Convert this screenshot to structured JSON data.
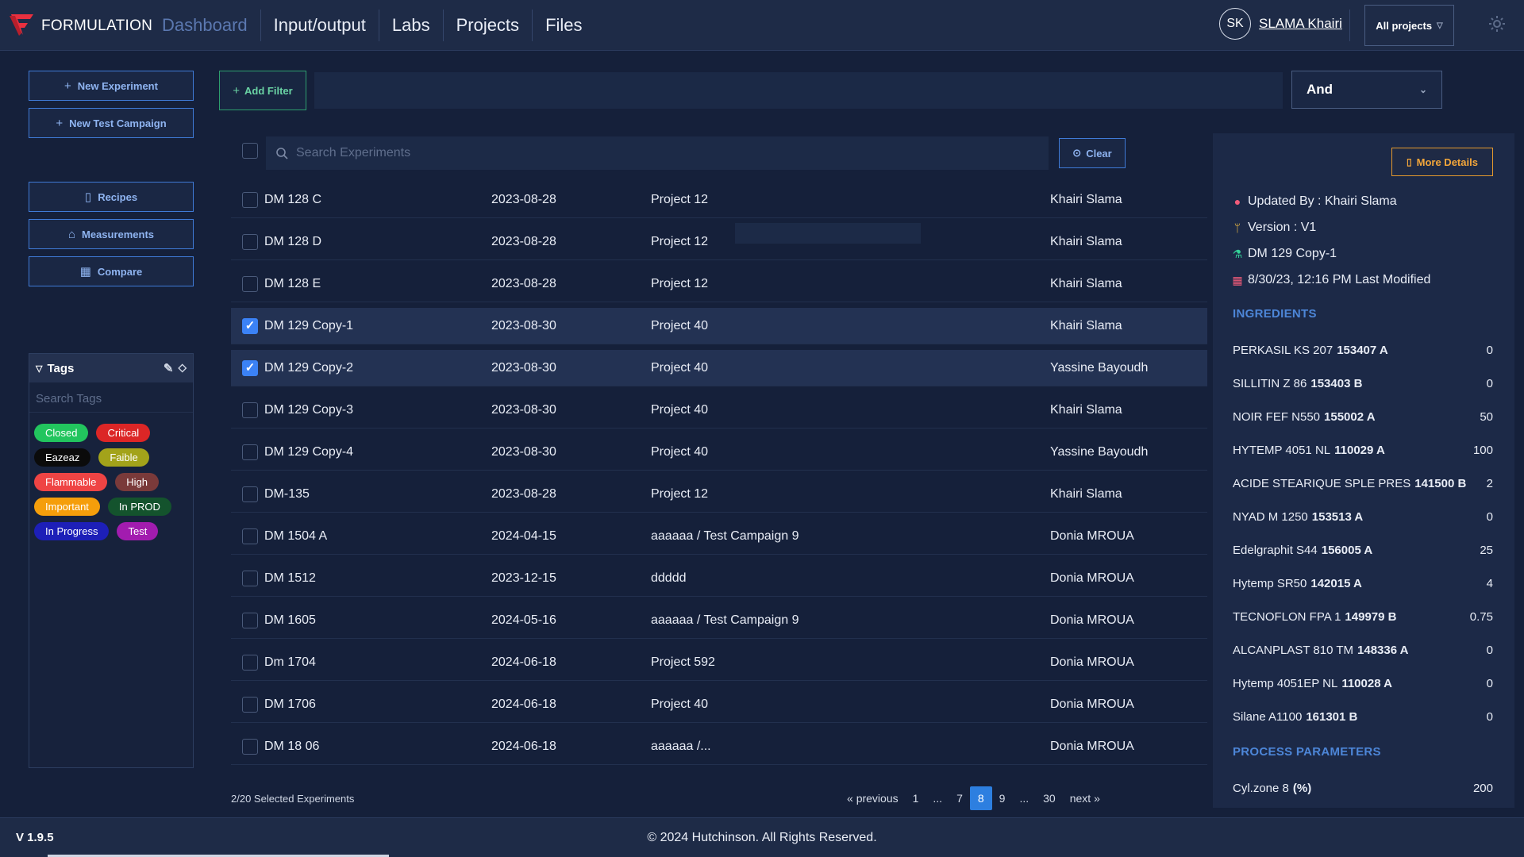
{
  "brand": {
    "name": "FORMULATION",
    "color": "#e8303f"
  },
  "nav": {
    "items": [
      "Dashboard",
      "Input/output",
      "Labs",
      "Projects",
      "Files"
    ],
    "active": "Dashboard"
  },
  "user": {
    "initials": "SK",
    "name": "SLAMA Khairi"
  },
  "project_select": {
    "value": "All projects"
  },
  "sidebar": {
    "new_experiment": "New Experiment",
    "new_test_campaign": "New Test Campaign",
    "recipes": "Recipes",
    "measurements": "Measurements",
    "compare": "Compare"
  },
  "tags": {
    "title": "Tags",
    "search_placeholder": "Search Tags",
    "items": [
      {
        "label": "Closed",
        "color": "#22c55e"
      },
      {
        "label": "Critical",
        "color": "#dc2626"
      },
      {
        "label": "Eazeaz",
        "color": "#0b0b0b"
      },
      {
        "label": "Faible",
        "color": "#a3a31a"
      },
      {
        "label": "Flammable",
        "color": "#ef4444"
      },
      {
        "label": "High",
        "color": "#7a3a3a"
      },
      {
        "label": "Important",
        "color": "#f59e0b"
      },
      {
        "label": "In PROD",
        "color": "#14532d"
      },
      {
        "label": "In Progress",
        "color": "#1d1fb8"
      },
      {
        "label": "Test",
        "color": "#a21caf"
      }
    ]
  },
  "filter": {
    "add_label": "Add Filter",
    "operator": "And"
  },
  "table": {
    "search_placeholder": "Search Experiments",
    "clear_label": "Clear",
    "rows": [
      {
        "name": "DM 128 C",
        "date": "2023-08-28",
        "project": "Project 12",
        "owner": "Khairi Slama",
        "checked": false
      },
      {
        "name": "DM 128 D",
        "date": "2023-08-28",
        "project": "Project 12",
        "owner": "Khairi Slama",
        "checked": false
      },
      {
        "name": "DM 128 E",
        "date": "2023-08-28",
        "project": "Project 12",
        "owner": "Khairi Slama",
        "checked": false
      },
      {
        "name": "DM 129 Copy-1",
        "date": "2023-08-30",
        "project": "Project 40",
        "owner": "Khairi Slama",
        "checked": true
      },
      {
        "name": "DM 129 Copy-2",
        "date": "2023-08-30",
        "project": "Project 40",
        "owner": "Yassine Bayoudh",
        "checked": true
      },
      {
        "name": "DM 129 Copy-3",
        "date": "2023-08-30",
        "project": "Project 40",
        "owner": "Khairi Slama",
        "checked": false
      },
      {
        "name": "DM 129 Copy-4",
        "date": "2023-08-30",
        "project": "Project 40",
        "owner": "Yassine Bayoudh",
        "checked": false
      },
      {
        "name": "DM-135",
        "date": "2023-08-28",
        "project": "Project 12",
        "owner": "Khairi Slama",
        "checked": false
      },
      {
        "name": "DM 1504 A",
        "date": "2024-04-15",
        "project": "aaaaaa / Test Campaign 9",
        "owner": "Donia MROUA",
        "checked": false
      },
      {
        "name": "DM 1512",
        "date": "2023-12-15",
        "project": "ddddd",
        "owner": "Donia MROUA",
        "checked": false
      },
      {
        "name": "DM 1605",
        "date": "2024-05-16",
        "project": "aaaaaa / Test Campaign 9",
        "owner": "Donia MROUA",
        "checked": false
      },
      {
        "name": "Dm 1704",
        "date": "2024-06-18",
        "project": "Project 592",
        "owner": "Donia MROUA",
        "checked": false
      },
      {
        "name": "DM 1706",
        "date": "2024-06-18",
        "project": "Project 40",
        "owner": "Donia MROUA",
        "checked": false
      },
      {
        "name": "DM 18 06",
        "date": "2024-06-18",
        "project": "aaaaaa /...",
        "owner": "Donia MROUA",
        "checked": false
      }
    ],
    "status": "2/20 Selected Experiments"
  },
  "pagination": {
    "previous": "previous",
    "next": "next",
    "pages": [
      "1",
      "...",
      "7",
      "8",
      "9",
      "...",
      "30"
    ],
    "current": "8"
  },
  "details": {
    "more_button": "More Details",
    "updated_by": "Updated By : Khairi Slama",
    "version": "Version : V1",
    "experiment": "DM 129 Copy-1",
    "last_modified": "8/30/23, 12:16 PM Last Modified",
    "ingredients_title": "INGREDIENTS",
    "ingredients": [
      {
        "name": "PERKASIL KS 207",
        "code": "153407 A",
        "value": "0"
      },
      {
        "name": "SILLITIN Z 86",
        "code": "153403 B",
        "value": "0"
      },
      {
        "name": "NOIR FEF N550",
        "code": "155002 A",
        "value": "50"
      },
      {
        "name": "HYTEMP 4051 NL",
        "code": "110029 A",
        "value": "100"
      },
      {
        "name": "ACIDE STEARIQUE SPLE PRES",
        "code": "141500 B",
        "value": "2"
      },
      {
        "name": "NYAD M 1250",
        "code": "153513 A",
        "value": "0"
      },
      {
        "name": "Edelgraphit S44",
        "code": "156005 A",
        "value": "25"
      },
      {
        "name": "Hytemp SR50",
        "code": "142015 A",
        "value": "4"
      },
      {
        "name": "TECNOFLON FPA 1",
        "code": "149979 B",
        "value": "0.75"
      },
      {
        "name": "ALCANPLAST 810 TM",
        "code": "148336 A",
        "value": "0"
      },
      {
        "name": "Hytemp 4051EP NL",
        "code": "110028 A",
        "value": "0"
      },
      {
        "name": "Silane A1100",
        "code": "161301 B",
        "value": "0"
      }
    ],
    "process_title": "PROCESS PARAMETERS",
    "process": [
      {
        "name": "Cyl.zone 8",
        "unit": "(%)",
        "value": "200"
      }
    ]
  },
  "footer": {
    "version": "V 1.9.5",
    "copyright": "© 2024 Hutchinson. All Rights Reserved."
  },
  "colors": {
    "accent_blue": "#3b82f6",
    "filter_green": "#2e9e6e",
    "details_orange": "#e69a2d",
    "section_blue": "#4d86d8"
  }
}
